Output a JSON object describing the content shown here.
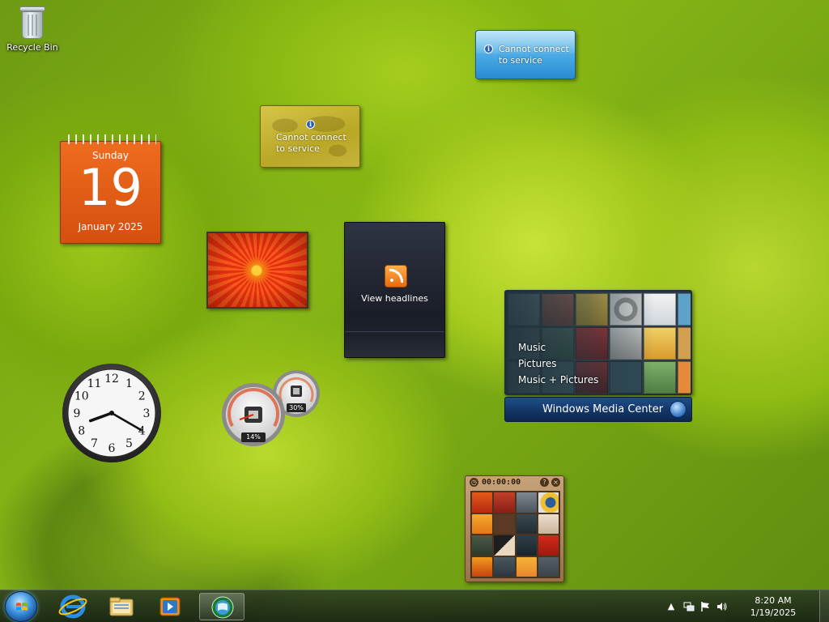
{
  "desktop": {
    "icons": [
      {
        "label": "Recycle Bin",
        "icon": "recycle-bin-icon"
      }
    ]
  },
  "gadgets": {
    "calendar": {
      "weekday": "Sunday",
      "day": "19",
      "month_year": "January 2025",
      "color": "#e45f17"
    },
    "weather_world": {
      "line1": "Cannot connect",
      "line2": "to service"
    },
    "weather_blue": {
      "line1": "Cannot connect",
      "line2": "to service"
    },
    "feeds": {
      "label": "View headlines"
    },
    "media_center": {
      "items": [
        "Music",
        "Pictures",
        "Music + Pictures"
      ],
      "title_bold": "Windows",
      "title_rest": " Media Center"
    },
    "clock": {
      "numerals": [
        "12",
        "1",
        "2",
        "3",
        "4",
        "5",
        "6",
        "7",
        "8",
        "9",
        "10",
        "11"
      ],
      "hour": 8,
      "minute": 20
    },
    "cpu_meter": {
      "cpu_percent": "14%",
      "memory_percent": "30%",
      "cpu_value": 14,
      "memory_value": 30
    },
    "puzzle": {
      "time": "00:00:00",
      "help_icon": "?",
      "close_icon": "×"
    }
  },
  "taskbar": {
    "pinned": [
      {
        "name": "internet-explorer-button",
        "icon": "internet-explorer-icon"
      },
      {
        "name": "windows-explorer-button",
        "icon": "folder-icon"
      },
      {
        "name": "media-player-button",
        "icon": "media-player-icon"
      },
      {
        "name": "media-center-button",
        "icon": "media-center-icon"
      }
    ],
    "tray": {
      "time": "8:20 AM",
      "date": "1/19/2025"
    }
  }
}
